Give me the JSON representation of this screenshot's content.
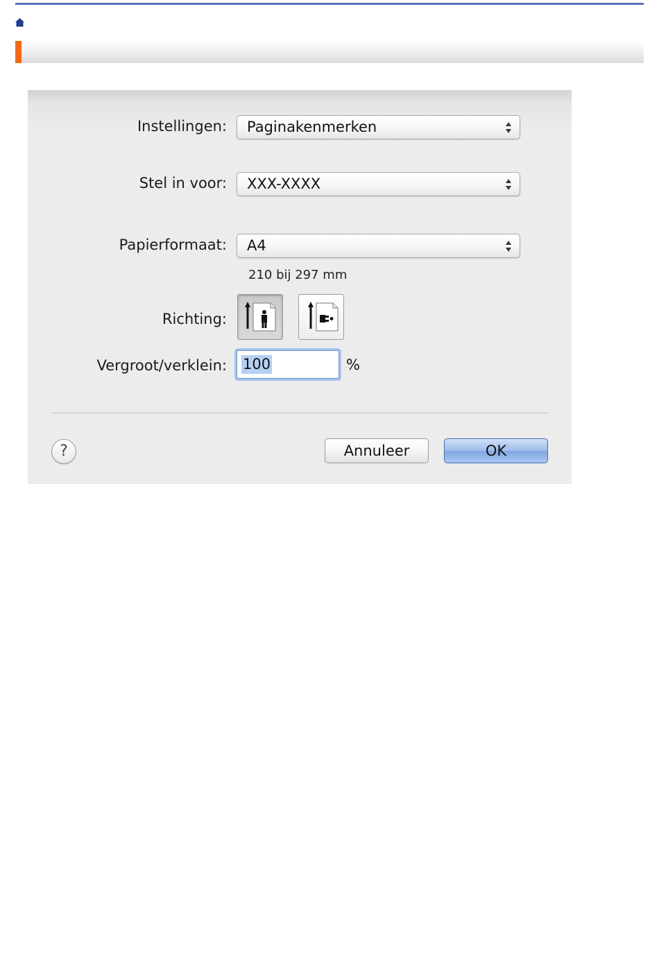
{
  "dialog": {
    "settings": {
      "label": "Instellingen:",
      "value": "Paginakenmerken"
    },
    "format_for": {
      "label": "Stel in voor:",
      "value": "XXX-XXXX"
    },
    "paper_size": {
      "label": "Papierformaat:",
      "value": "A4",
      "dimensions": "210 bij 297 mm"
    },
    "orientation": {
      "label": "Richting:",
      "options": [
        "portrait",
        "landscape"
      ],
      "selected": "portrait"
    },
    "scale": {
      "label": "Vergroot/verklein:",
      "value": "100",
      "unit": "%"
    },
    "buttons": {
      "help": "?",
      "cancel": "Annuleer",
      "ok": "OK"
    }
  },
  "colors": {
    "accent": "#f06a1a",
    "top_rule": "#5a6fb8",
    "home_icon": "#1e3f8f",
    "ok_button": "#8fb2e6"
  },
  "icons": [
    "home-icon",
    "popup-arrows-icon",
    "portrait-orientation-icon",
    "landscape-orientation-icon",
    "help-icon"
  ]
}
